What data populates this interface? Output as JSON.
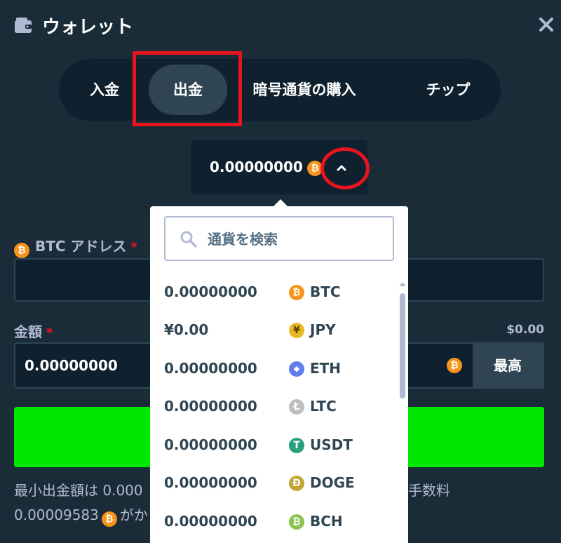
{
  "header": {
    "title": "ウォレット",
    "wallet_icon": "wallet-icon",
    "close_icon": "close-icon"
  },
  "tabs": [
    {
      "label": "入金",
      "active": false
    },
    {
      "label": "出金",
      "active": true
    },
    {
      "label": "暗号通貨の購入",
      "active": false
    },
    {
      "label": "チップ",
      "active": false
    }
  ],
  "balance": {
    "value": "0.00000000",
    "currency_icon": "btc-icon",
    "chevron_icon": "chevron-up-icon"
  },
  "address": {
    "coin_symbol": "₿",
    "label": "BTC アドレス",
    "required_mark": "*",
    "value": ""
  },
  "amount": {
    "label": "金額",
    "required_mark": "*",
    "usd_value": "$0.00",
    "value": "0.00000000",
    "max_label": "最高"
  },
  "note": {
    "line1": "最小出金額は 0.000",
    "line1_right": "手数料",
    "line2_start": "0.00009583",
    "line2_end": "がか"
  },
  "dropdown": {
    "search_placeholder": "通貨を検索",
    "currencies": [
      {
        "amount": "0.00000000",
        "code": "BTC",
        "symbol": "₿",
        "color": "#f7931a"
      },
      {
        "amount": "¥0.00",
        "code": "JPY",
        "symbol": "¥",
        "color": "#e8b923"
      },
      {
        "amount": "0.00000000",
        "code": "ETH",
        "symbol": "◆",
        "color": "#627eea"
      },
      {
        "amount": "0.00000000",
        "code": "LTC",
        "symbol": "Ł",
        "color": "#bebebe"
      },
      {
        "amount": "0.00000000",
        "code": "USDT",
        "symbol": "T",
        "color": "#26a17b"
      },
      {
        "amount": "0.00000000",
        "code": "DOGE",
        "symbol": "Ð",
        "color": "#c2a633"
      },
      {
        "amount": "0.00000000",
        "code": "BCH",
        "symbol": "₿",
        "color": "#8dc351"
      }
    ]
  },
  "colors": {
    "background": "#1a2c38",
    "panel": "#0f212e",
    "accent_green": "#00e701",
    "highlight_red": "#e8141e",
    "btc_orange": "#f7931a"
  }
}
